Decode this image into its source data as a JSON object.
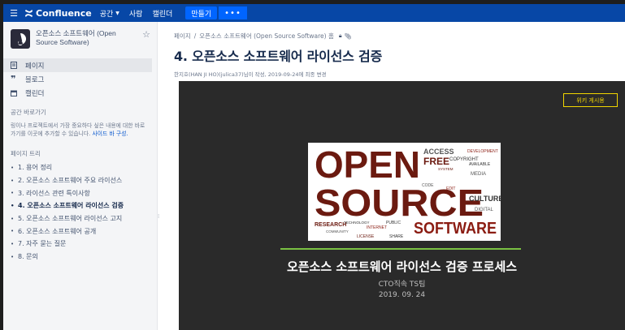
{
  "topnav": {
    "logo_text": "Confluence",
    "items": [
      "공간",
      "사람",
      "캘린더"
    ],
    "create_label": "만들기",
    "more_label": "•••",
    "color": "#0747a6",
    "accent": "#0065ff"
  },
  "sidebar": {
    "space_title": "오픈소스 소프트웨어 (Open Source Software)",
    "nav": [
      {
        "icon": "document-icon",
        "label": "페이지"
      },
      {
        "icon": "quote-icon",
        "label": "블로그"
      },
      {
        "icon": "calendar-icon",
        "label": "캘린더"
      }
    ],
    "shortcuts_label": "공간 바로가기",
    "shortcuts_text": "링이나 프로젝트에서 가장 중요하다 싶은 내용에 대한 바로가기를 이곳에 추가할 수 있습니다.",
    "shortcuts_link": "사이드 바 구성.",
    "tree_label": "페이지 트리",
    "tree": [
      "1. 용어 정리",
      "2. 오픈소스 소프트웨어 주요 라이선스",
      "3. 라이선스 관련 특이사항",
      "4. 오픈소스 소프트웨어 라이선스 검증",
      "5. 오픈소스 소프트웨어 라이선스 고지",
      "6. 오픈소스 소프트웨어 공개",
      "7. 자주 묻는 질문",
      "8. 문의"
    ],
    "current_index": 3
  },
  "main": {
    "breadcrumb": [
      "페이지",
      "오픈소스 소프트웨어 (Open Source Software) 홈"
    ],
    "title": "4. 오픈소스 소프트웨어 라이선스 검증",
    "byline": "한지호(HAN JI HO)(julica37)님이 작성, 2019-09-24에 최종 변경"
  },
  "slide": {
    "badge": "위키 게시용",
    "title": "오픈소스 소프트웨어 라이선스 검증 프로세스",
    "team": "CTO직속 TS팀",
    "date": "2019. 09. 24",
    "image": {
      "big_words": [
        "OPEN",
        "SOURCE",
        "SOFTWARE"
      ],
      "small_words": [
        "ACCESS",
        "FREE",
        "COPYRIGHT",
        "DEVELOPMENT",
        "AVAILABLE",
        "MEDIA",
        "CULTURE",
        "DIGITAL",
        "RESEARCH",
        "TECHNOLOGY",
        "COMMUNITY",
        "INTERNET",
        "PUBLIC",
        "LICENSE",
        "CODE",
        "EDIT",
        "SHARE",
        "SYSTEM"
      ]
    }
  }
}
